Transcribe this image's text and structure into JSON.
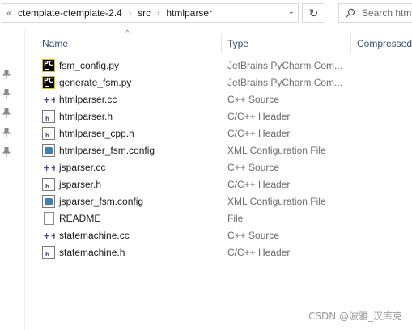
{
  "address_bar": {
    "crumbs": [
      "ctemplate-ctemplate-2.4",
      "src",
      "htmlparser"
    ],
    "overflow_glyph": "«",
    "separator_glyph": "›",
    "dropdown_glyph": "⌄",
    "refresh_glyph": "↻",
    "search_placeholder": "Search htm"
  },
  "columns": {
    "sort_glyph": "^",
    "name": "Name",
    "type": "Type",
    "compressed": "Compressed"
  },
  "files": [
    {
      "name": "fsm_config.py",
      "type": "JetBrains PyCharm Com...",
      "icon": "pycharm-file-icon"
    },
    {
      "name": "generate_fsm.py",
      "type": "JetBrains PyCharm Com...",
      "icon": "pycharm-file-icon"
    },
    {
      "name": "htmlparser.cc",
      "type": "C++ Source",
      "icon": "cpp-source-icon"
    },
    {
      "name": "htmlparser.h",
      "type": "C/C++ Header",
      "icon": "c-header-icon"
    },
    {
      "name": "htmlparser_cpp.h",
      "type": "C/C++ Header",
      "icon": "c-header-icon"
    },
    {
      "name": "htmlparser_fsm.config",
      "type": "XML Configuration File",
      "icon": "xml-config-icon"
    },
    {
      "name": "jsparser.cc",
      "type": "C++ Source",
      "icon": "cpp-source-icon"
    },
    {
      "name": "jsparser.h",
      "type": "C/C++ Header",
      "icon": "c-header-icon"
    },
    {
      "name": "jsparser_fsm.config",
      "type": "XML Configuration File",
      "icon": "xml-config-icon"
    },
    {
      "name": "README",
      "type": "File",
      "icon": "blank-file-icon"
    },
    {
      "name": "statemachine.cc",
      "type": "C++ Source",
      "icon": "cpp-source-icon"
    },
    {
      "name": "statemachine.h",
      "type": "C/C++ Header",
      "icon": "c-header-icon"
    }
  ],
  "watermark": "CSDN @波雅_汉库克",
  "colors": {
    "header_text": "#3b4e6b",
    "type_text": "#6d6d6d",
    "cpp_icon": "#5a3f8f"
  }
}
